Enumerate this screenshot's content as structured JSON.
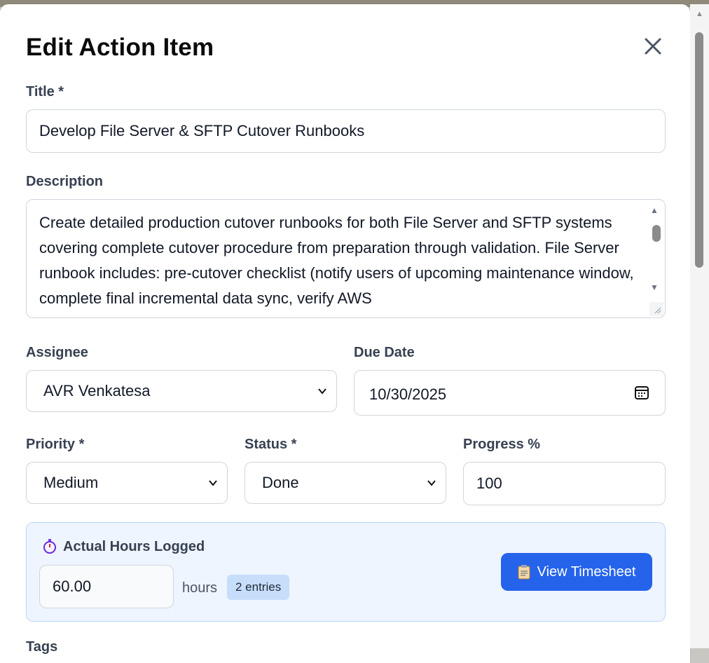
{
  "modal": {
    "title": "Edit Action Item"
  },
  "form": {
    "title_label": "Title *",
    "title_value": "Develop File Server & SFTP Cutover Runbooks",
    "description_label": "Description",
    "description_value": "Create detailed production cutover runbooks for both File Server and SFTP systems covering complete cutover procedure from preparation through validation. File Server runbook includes: pre-cutover checklist (notify users of upcoming maintenance window, complete final incremental data sync, verify AWS",
    "assignee_label": "Assignee",
    "assignee_value": "AVR Venkatesa",
    "due_date_label": "Due Date",
    "due_date_value": "10/30/2025",
    "priority_label": "Priority *",
    "priority_value": "Medium",
    "status_label": "Status *",
    "status_value": "Done",
    "progress_label": "Progress %",
    "progress_value": "100",
    "tags_label": "Tags"
  },
  "hours": {
    "title": "Actual Hours Logged",
    "value": "60.00",
    "unit": "hours",
    "entries_badge": "2 entries",
    "view_button": "View Timesheet"
  },
  "icons": {
    "close": "close-icon",
    "calendar": "calendar-icon",
    "stopwatch": "stopwatch-icon",
    "clipboard": "clipboard-icon"
  },
  "colors": {
    "primary": "#2563eb",
    "panel_bg": "#eef5ff",
    "badge_bg": "#c7defb"
  }
}
